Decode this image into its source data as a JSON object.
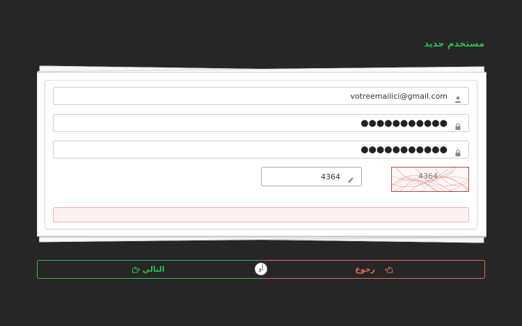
{
  "header": {
    "title": "مستخدم جديد"
  },
  "form": {
    "email_value": "votreemailici@gmail.com",
    "password_value": "●●●●●●●●●●●",
    "confirm_password_value": "●●●●●●●●●●●",
    "captcha_input_value": "4364",
    "captcha_image_text": "4364"
  },
  "buttons": {
    "back_label": "رجوع",
    "next_label": "التالي",
    "or_label": "أو"
  },
  "colors": {
    "background": "#262626",
    "accent_green": "#2ec04a",
    "accent_red": "#e0665c"
  },
  "icons": {
    "email": "user-icon",
    "password": "lock-icon",
    "captcha": "pencil-icon",
    "back": "hand-point-left-icon",
    "next": "hand-point-right-icon"
  }
}
